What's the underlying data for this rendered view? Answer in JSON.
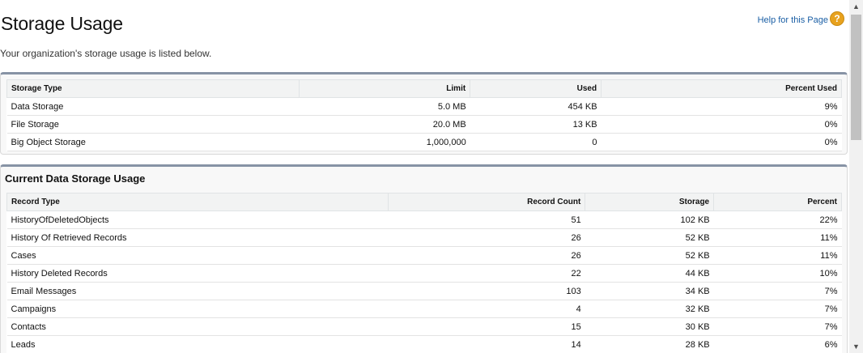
{
  "header": {
    "title": "Storage Usage",
    "subtitle": "Your organization's storage usage is listed below.",
    "help_link": "Help for this Page",
    "help_icon": "?"
  },
  "storage_table": {
    "columns": [
      "Storage Type",
      "Limit",
      "Used",
      "Percent Used"
    ],
    "rows": [
      [
        "Data Storage",
        "5.0 MB",
        "454 KB",
        "9%"
      ],
      [
        "File Storage",
        "20.0 MB",
        "13 KB",
        "0%"
      ],
      [
        "Big Object Storage",
        "1,000,000",
        "0",
        "0%"
      ]
    ]
  },
  "data_usage": {
    "title": "Current Data Storage Usage",
    "columns": [
      "Record Type",
      "Record Count",
      "Storage",
      "Percent"
    ],
    "rows": [
      [
        "HistoryOfDeletedObjects",
        "51",
        "102 KB",
        "22%"
      ],
      [
        "History Of Retrieved Records",
        "26",
        "52 KB",
        "11%"
      ],
      [
        "Cases",
        "26",
        "52 KB",
        "11%"
      ],
      [
        "History Deleted Records",
        "22",
        "44 KB",
        "10%"
      ],
      [
        "Email Messages",
        "103",
        "34 KB",
        "7%"
      ],
      [
        "Campaigns",
        "4",
        "32 KB",
        "7%"
      ],
      [
        "Contacts",
        "15",
        "30 KB",
        "7%"
      ],
      [
        "Leads",
        "14",
        "28 KB",
        "6%"
      ]
    ]
  },
  "scrollbar": {
    "up_icon": "▲",
    "down_icon": "▼"
  }
}
